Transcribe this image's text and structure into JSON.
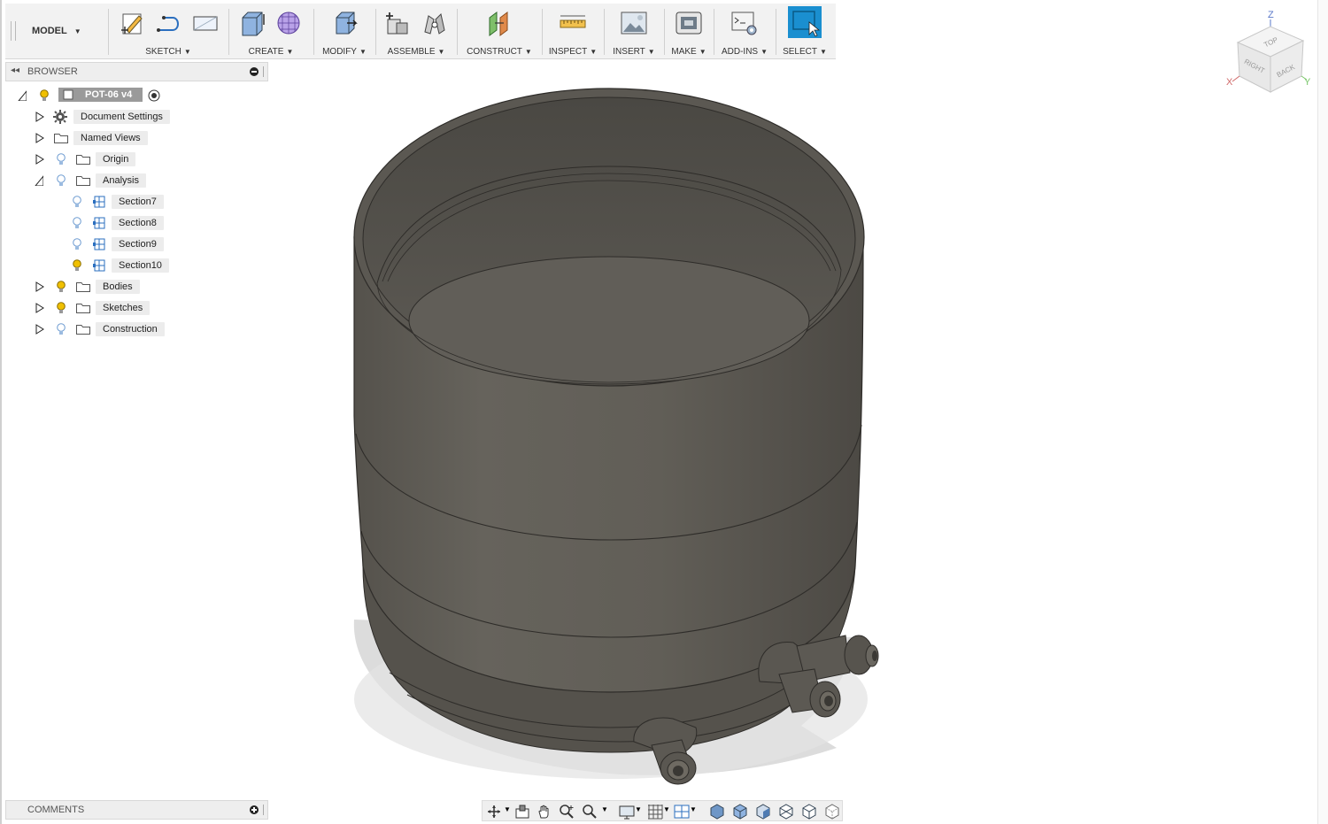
{
  "toolbar": {
    "workspace": "MODEL",
    "groups": [
      {
        "label": "SKETCH"
      },
      {
        "label": "CREATE"
      },
      {
        "label": "MODIFY"
      },
      {
        "label": "ASSEMBLE"
      },
      {
        "label": "CONSTRUCT"
      },
      {
        "label": "INSPECT"
      },
      {
        "label": "INSERT"
      },
      {
        "label": "MAKE"
      },
      {
        "label": "ADD-INS"
      },
      {
        "label": "SELECT"
      }
    ],
    "accent": "#1a8fd0"
  },
  "browser": {
    "title": "BROWSER",
    "root": {
      "label": "POT-06 v4"
    },
    "items": [
      {
        "label": "Document Settings",
        "icon": "gear-icon"
      },
      {
        "label": "Named Views",
        "icon": "folder-icon"
      },
      {
        "label": "Origin",
        "icon": "folder-icon"
      },
      {
        "label": "Analysis",
        "icon": "folder-icon",
        "expanded": true
      },
      {
        "label": "Section7",
        "icon": "section-analysis-icon"
      },
      {
        "label": "Section8",
        "icon": "section-analysis-icon"
      },
      {
        "label": "Section9",
        "icon": "section-analysis-icon"
      },
      {
        "label": "Section10",
        "icon": "section-analysis-icon"
      },
      {
        "label": "Bodies",
        "icon": "folder-icon"
      },
      {
        "label": "Sketches",
        "icon": "folder-icon"
      },
      {
        "label": "Construction",
        "icon": "folder-icon"
      }
    ]
  },
  "comments": {
    "title": "COMMENTS"
  },
  "viewcube": {
    "face_top": "TOP",
    "face_right": "RIGHT",
    "face_back": "BACK",
    "axis_x": "X",
    "axis_y": "Y",
    "axis_z": "Z"
  },
  "colors": {
    "model_body": "#5e5b55",
    "model_dark": "#3f3d39",
    "bulb_on": "#f0c000",
    "bulb_off": "#9bbbe0"
  }
}
